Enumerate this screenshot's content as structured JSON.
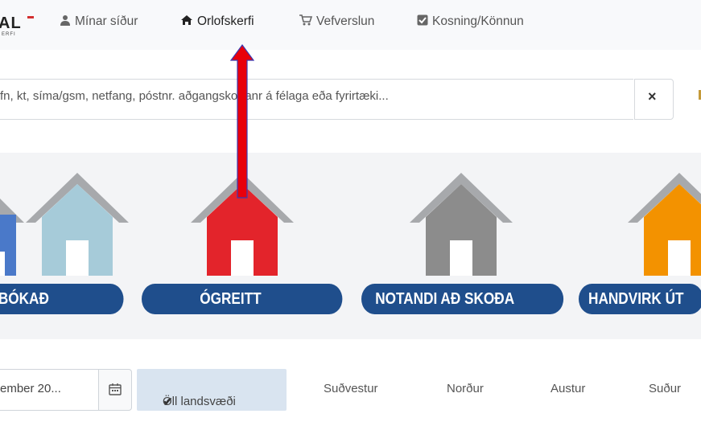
{
  "brand": {
    "logo_text": "AL",
    "logo_sub": "ERFI"
  },
  "nav": {
    "items": [
      {
        "label": "Mínar síður",
        "icon": "user-icon"
      },
      {
        "label": "Orlofskerfi",
        "icon": "home-icon"
      },
      {
        "label": "Vefverslun",
        "icon": "cart-icon"
      },
      {
        "label": "Kosning/Könnun",
        "icon": "checkbox-icon"
      }
    ]
  },
  "search": {
    "value": "fn, kt, síma/gsm, netfang, póstnr. aðgangskortanr á félaga eða fyrirtæki...",
    "clear_label": "×"
  },
  "categories": [
    {
      "label": "BÓKAÐ",
      "color": "#4a79c9"
    },
    {
      "label": "ÓGREITT",
      "color": "#e3242b"
    },
    {
      "label": "NOTANDI AÐ SKOÐA",
      "color": "#8c8c8c"
    },
    {
      "label": "HANDVIRK ÚT",
      "color": "#f39200"
    }
  ],
  "filters": {
    "date_value": "ember 20...",
    "calendar_icon": "calendar-icon",
    "regions": [
      {
        "label": "Öll landsvæði",
        "active": true
      },
      {
        "label": "Suðvestur"
      },
      {
        "label": "Norður"
      },
      {
        "label": "Austur"
      },
      {
        "label": "Suður"
      }
    ]
  },
  "colors": {
    "pill_blue": "#1f4e8c",
    "annotation_red": "#e8000b",
    "house_roof_gray": "#a7a9ac",
    "house_light_blue": "#a6cbd9"
  }
}
